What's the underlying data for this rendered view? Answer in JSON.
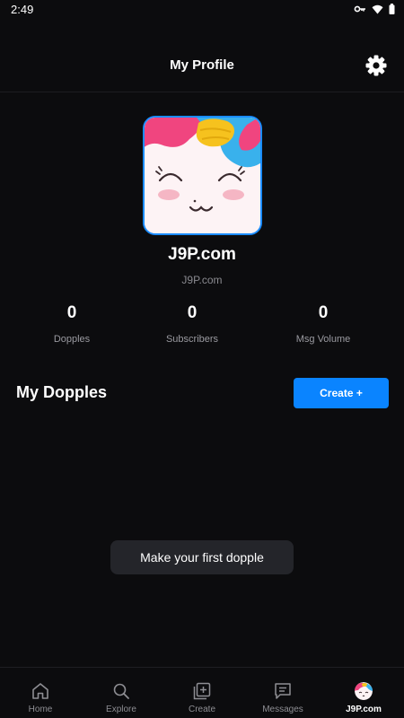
{
  "status_bar": {
    "time": "2:49",
    "icons": [
      "vpn-key-icon",
      "wifi-icon",
      "battery-icon"
    ]
  },
  "header": {
    "title": "My Profile",
    "settings_icon": "gear-icon"
  },
  "profile": {
    "name": "J9P.com",
    "handle": "J9P.com",
    "avatar_border_color": "#1a8cff"
  },
  "stats": [
    {
      "value": "0",
      "label": "Dopples"
    },
    {
      "value": "0",
      "label": "Subscribers"
    },
    {
      "value": "0",
      "label": "Msg Volume"
    }
  ],
  "dopples_section": {
    "title": "My Dopples",
    "create_label": "Create +",
    "empty_label": "Make your first dopple"
  },
  "bottom_nav": {
    "items": [
      {
        "label": "Home",
        "icon": "home-icon",
        "active": false
      },
      {
        "label": "Explore",
        "icon": "search-icon",
        "active": false
      },
      {
        "label": "Create",
        "icon": "plus-square-icon",
        "active": false
      },
      {
        "label": "Messages",
        "icon": "message-icon",
        "active": false
      },
      {
        "label": "J9P.com",
        "icon": "profile-avatar",
        "active": true
      }
    ]
  },
  "colors": {
    "background": "#0c0c0e",
    "accent": "#0a84ff",
    "muted_text": "#8a8a90",
    "empty_button_bg": "#24252a"
  }
}
